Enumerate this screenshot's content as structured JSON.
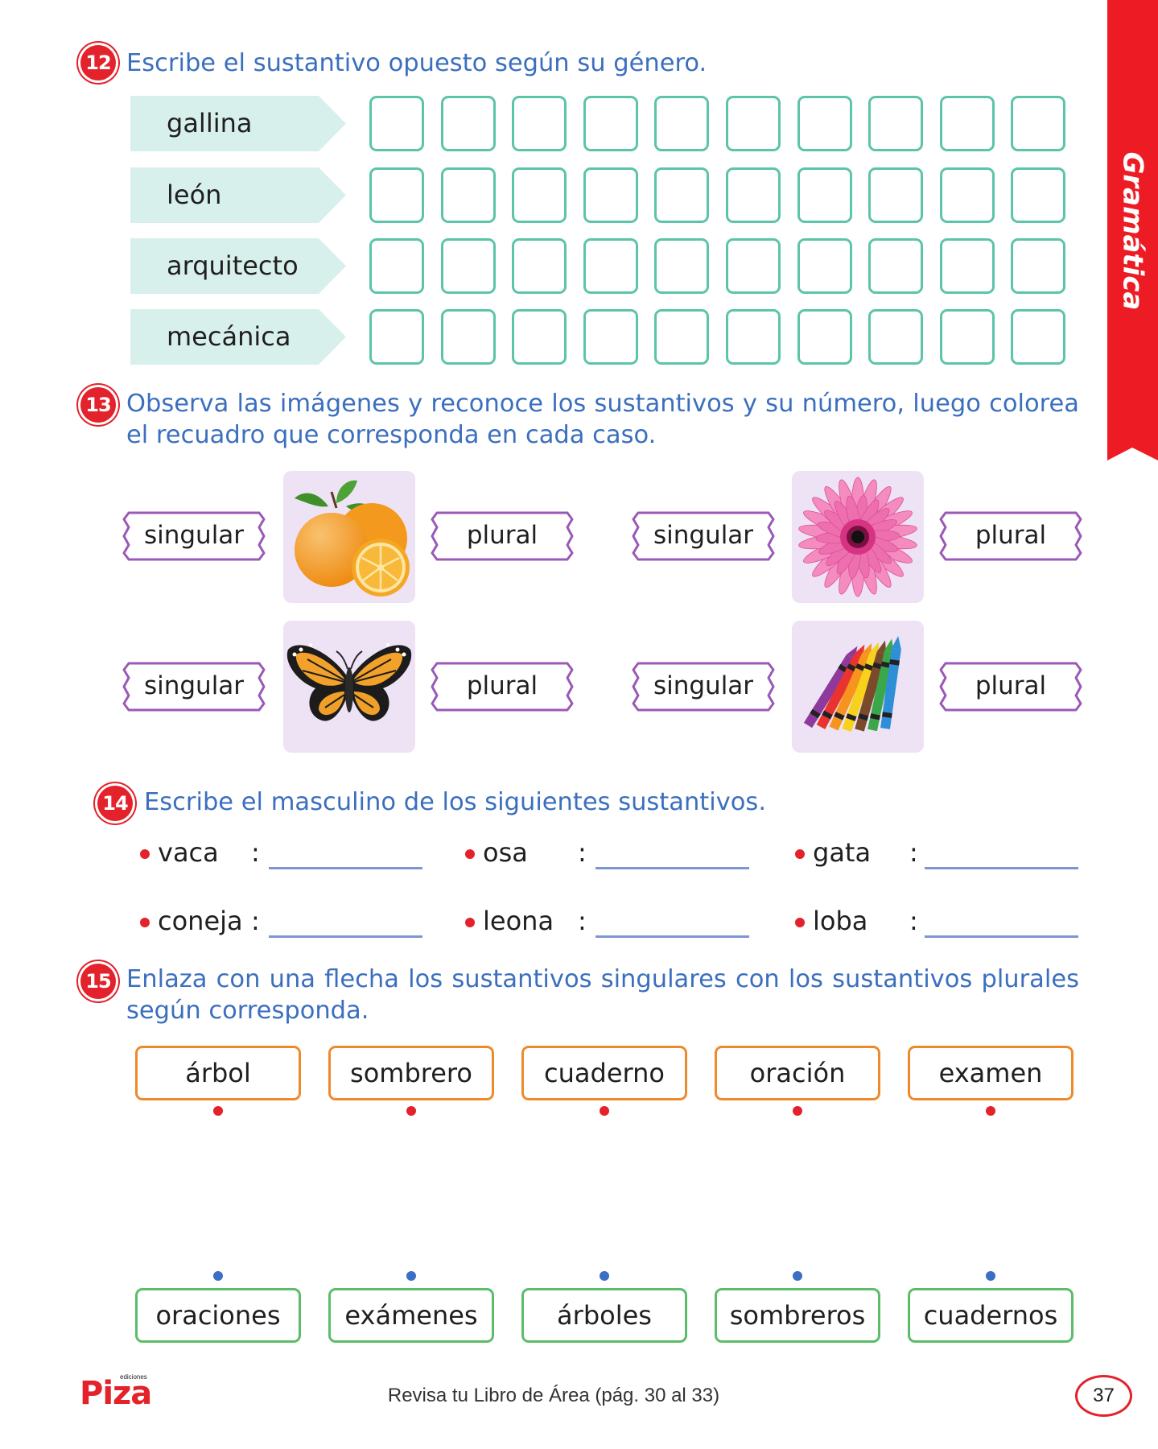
{
  "side_tab": {
    "label": "Gramática",
    "color": "#ed1c24"
  },
  "ex12": {
    "number": "12",
    "title": "Escribe el sustantivo opuesto según su género.",
    "words": [
      "gallina",
      "león",
      "arquitecto",
      "mecánica"
    ],
    "boxes_per_row": 10
  },
  "ex13": {
    "number": "13",
    "title": "Observa las imágenes y reconoce los sustantivos y su número, luego colorea el recuadro que corresponda en cada caso.",
    "items": [
      {
        "left_label": "singular",
        "right_label": "plural",
        "picture": "oranges-image"
      },
      {
        "left_label": "singular",
        "right_label": "plural",
        "picture": "flower-image"
      },
      {
        "left_label": "singular",
        "right_label": "plural",
        "picture": "butterfly-image"
      },
      {
        "left_label": "singular",
        "right_label": "plural",
        "picture": "crayons-image"
      }
    ]
  },
  "ex14": {
    "number": "14",
    "title": "Escribe el masculino de los siguientes sustantivos.",
    "items": [
      "vaca",
      "osa",
      "gata",
      "coneja",
      "leona",
      "loba"
    ],
    "colon": ":"
  },
  "ex15": {
    "number": "15",
    "title": "Enlaza con una flecha los sustantivos singulares con los sustantivos plurales según corresponda.",
    "singulars": [
      "árbol",
      "sombrero",
      "cuaderno",
      "oración",
      "examen"
    ],
    "plurals": [
      "oraciones",
      "exámenes",
      "árboles",
      "sombreros",
      "cuadernos"
    ]
  },
  "footer": {
    "text": "Revisa tu Libro de Área (pág. 30 al 33)",
    "page_number": "37",
    "logo_word": "Piza",
    "logo_small": "ediciones"
  }
}
